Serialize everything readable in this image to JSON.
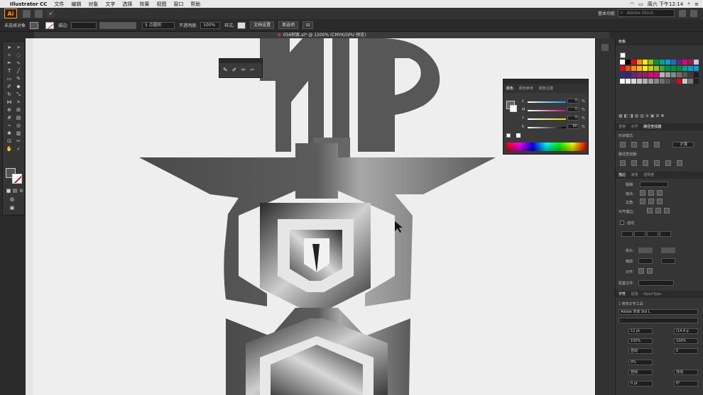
{
  "menubar": {
    "app_name": "Illustrator CC",
    "items": [
      "文件",
      "编辑",
      "对象",
      "文字",
      "选择",
      "效果",
      "视图",
      "窗口",
      "帮助"
    ],
    "clock": "周六 下午12:14"
  },
  "appbar": {
    "logo": "Ai",
    "workspace": "基本功能",
    "search_placeholder": "Adobe Stock"
  },
  "control_bar": {
    "selection_label": "未选择对象",
    "stroke_label": "描边:",
    "brush_value": "5 点圆形",
    "opacity_label": "不透明度:",
    "opacity_value": "100%",
    "style_label": "样式:",
    "doc_setup_button": "文档设置",
    "prefs_button": "首选项"
  },
  "document": {
    "tab_title": "056刺客.ai* @ 1200% (CMYK/GPU 预览)"
  },
  "pencil_panel": {
    "icons": [
      "pencil-icon",
      "smooth-tool-icon",
      "path-eraser-icon",
      "join-tool-icon"
    ]
  },
  "color_panel": {
    "tabs": [
      "颜色",
      "颜色参考",
      "颜色主题"
    ],
    "active_tab": "颜色",
    "channels": [
      {
        "label": "C",
        "value": "0",
        "pct": "%",
        "color": "#00a0e0"
      },
      {
        "label": "M",
        "value": "0",
        "pct": "%",
        "color": "#e0007a"
      },
      {
        "label": "Y",
        "value": "0",
        "pct": "%",
        "color": "#e8d800"
      },
      {
        "label": "K",
        "value": "80",
        "pct": "%",
        "color": "#ffffff"
      }
    ]
  },
  "right_panel": {
    "swatches_title": "色板",
    "transform_tabs": [
      "变换",
      "对齐",
      "路径查找器"
    ],
    "pathfinder_active": "路径查找器",
    "shape_modes_label": "形状模式:",
    "expand_button": "扩展",
    "pathfinders_label": "路径查找器:",
    "stroke_tabs": [
      "描边",
      "渐变",
      "透明度"
    ],
    "stroke_active": "描边",
    "weight_label": "粗细:",
    "cap_label": "端点:",
    "corner_label": "边角:",
    "align_stroke_label": "对齐描边:",
    "dashed_label": "虚线",
    "arrow_label": "箭头:",
    "scale_label": "缩放:",
    "align_label": "对齐:",
    "profile_label": "配置文件:",
    "char_tabs": [
      "字符",
      "段落",
      "OpenType"
    ],
    "char_active": "字符",
    "touch_type_label": "修饰文字工具",
    "font_name": "Adobe 宋体 Std L",
    "font_style": "-",
    "font_size": "12 pt",
    "leading": "(14.4 p",
    "h_scale": "100%",
    "v_scale": "100%",
    "kerning": "自动",
    "tracking": "0",
    "tsume": "0%",
    "auto1": "自动",
    "auto2": "自动",
    "baseline": "0 pt",
    "rotation": "0°"
  }
}
